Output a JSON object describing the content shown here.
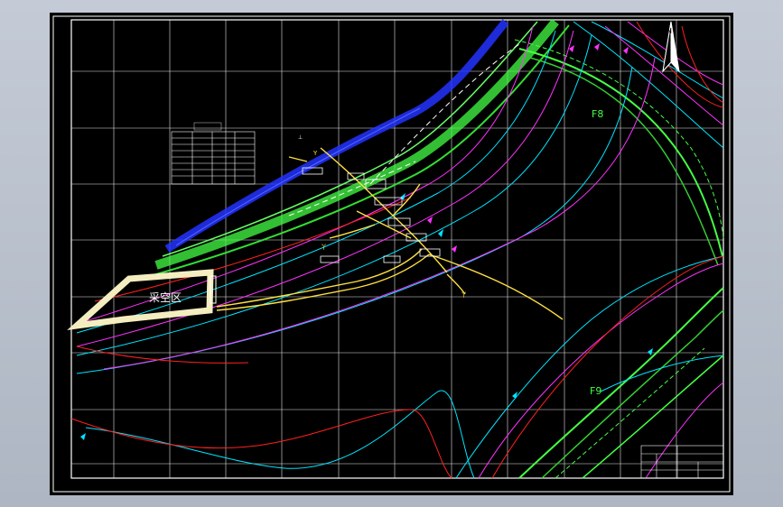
{
  "drawing": {
    "area_label": "采空区",
    "fault_label_top": "F8",
    "fault_label_bottom": "F9",
    "north_symbol": "north-arrow-icon"
  },
  "colors": {
    "background": "#000000",
    "grid": "#ffffff",
    "contour_cyan": "#00e5ff",
    "contour_magenta": "#ff33ff",
    "contour_red": "#ff2020",
    "fault_green": "#44ff44",
    "boundary_blue": "#2233ff",
    "roadway_yellow": "#ffe040",
    "goaf_fill": "#f4edc0"
  }
}
